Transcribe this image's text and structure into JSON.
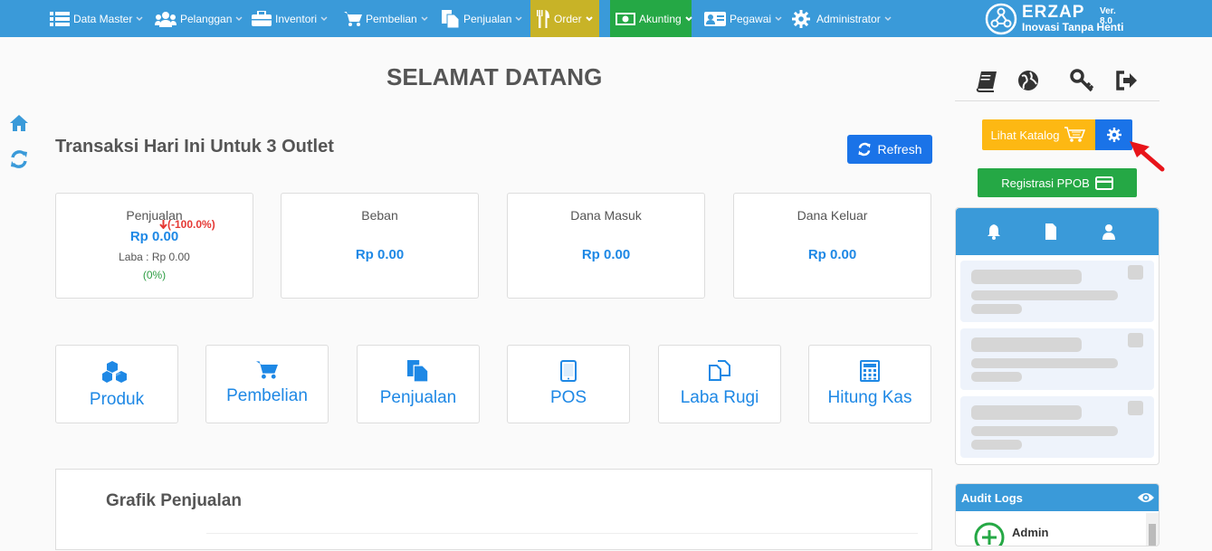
{
  "nav": {
    "items": [
      {
        "label": "Data Master",
        "icon": "list-icon"
      },
      {
        "label": "Pelanggan",
        "icon": "users-icon"
      },
      {
        "label": "Inventori",
        "icon": "briefcase-icon"
      },
      {
        "label": "Pembelian",
        "icon": "cart-icon"
      },
      {
        "label": "Penjualan",
        "icon": "documents-icon"
      },
      {
        "label": "Order",
        "icon": "cutlery-icon",
        "active_color": "#c8b327"
      },
      {
        "label": "Akunting",
        "icon": "money-icon",
        "active_color": "#25a845"
      },
      {
        "label": "Pegawai",
        "icon": "id-card-icon"
      },
      {
        "label": "Administrator",
        "icon": "gear-icon"
      }
    ],
    "brand": {
      "name": "ERZAP",
      "tagline": "Inovasi Tanpa Henti",
      "version": "Ver. 8.0"
    }
  },
  "main": {
    "title": "SELAMAT DATANG",
    "subtitle": "Transaksi Hari Ini Untuk 3 Outlet",
    "refresh_label": "Refresh",
    "stats": [
      {
        "label": "Penjualan",
        "value": "Rp 0.00",
        "change": "(-100.0%)",
        "laba": "Laba : Rp 0.00",
        "laba_pct": "(0%)"
      },
      {
        "label": "Beban",
        "value": "Rp 0.00"
      },
      {
        "label": "Dana Masuk",
        "value": "Rp 0.00"
      },
      {
        "label": "Dana Keluar",
        "value": "Rp 0.00"
      }
    ],
    "quick_links": [
      {
        "label": "Produk",
        "icon": "cubes-icon"
      },
      {
        "label": "Pembelian",
        "icon": "cart-icon"
      },
      {
        "label": "Penjualan",
        "icon": "documents-icon"
      },
      {
        "label": "POS",
        "icon": "tablet-icon"
      },
      {
        "label": "Laba Rugi",
        "icon": "copy-icon"
      },
      {
        "label": "Hitung Kas",
        "icon": "calculator-icon"
      }
    ],
    "chart_title": "Grafik Penjualan"
  },
  "right": {
    "katalog_label": "Lihat Katalog",
    "ppob_label": "Registrasi PPOB",
    "tools": [
      "book-icon",
      "globe-icon",
      "key-icon",
      "sign-out-icon"
    ],
    "notif_tabs": [
      "bell-icon",
      "file-icon",
      "user-icon"
    ],
    "audit_title": "Audit Logs",
    "audit_user": "Admin"
  },
  "colors": {
    "primary": "#3a9ad9",
    "accent_blue": "#1a73e8",
    "value_blue": "#1e88e5",
    "warning": "#fdb813",
    "success": "#25a845",
    "danger": "#e53935"
  }
}
